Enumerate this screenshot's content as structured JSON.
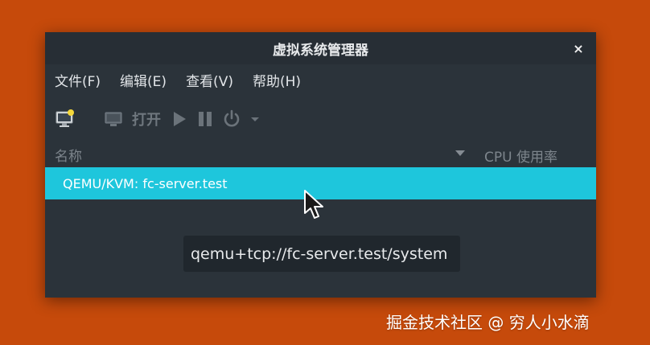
{
  "window": {
    "title": "虚拟系统管理器",
    "close_label": "×"
  },
  "menubar": {
    "items": [
      {
        "label": "文件(F)"
      },
      {
        "label": "编辑(E)"
      },
      {
        "label": "查看(V)"
      },
      {
        "label": "帮助(H)"
      }
    ]
  },
  "toolbar": {
    "new_vm_icon": "new-vm-icon",
    "console_icon": "console-icon",
    "open_label": "打开",
    "run_icon": "play-icon",
    "pause_icon": "pause-icon",
    "power_icon": "power-icon",
    "dropdown_icon": "chevron-down-icon"
  },
  "columns": {
    "name": "名称",
    "cpu": "CPU 使用率"
  },
  "connections": [
    {
      "label": "QEMU/KVM: fc-server.test",
      "selected": true
    }
  ],
  "tooltip": {
    "text": "qemu+tcp://fc-server.test/system"
  },
  "watermark": {
    "text": "掘金技术社区 @ 穷人小水滴"
  },
  "colors": {
    "desktop": "#c64a0b",
    "window_bg": "#2b333a",
    "selection": "#1ec6dc",
    "tooltip_bg": "#20272d"
  }
}
